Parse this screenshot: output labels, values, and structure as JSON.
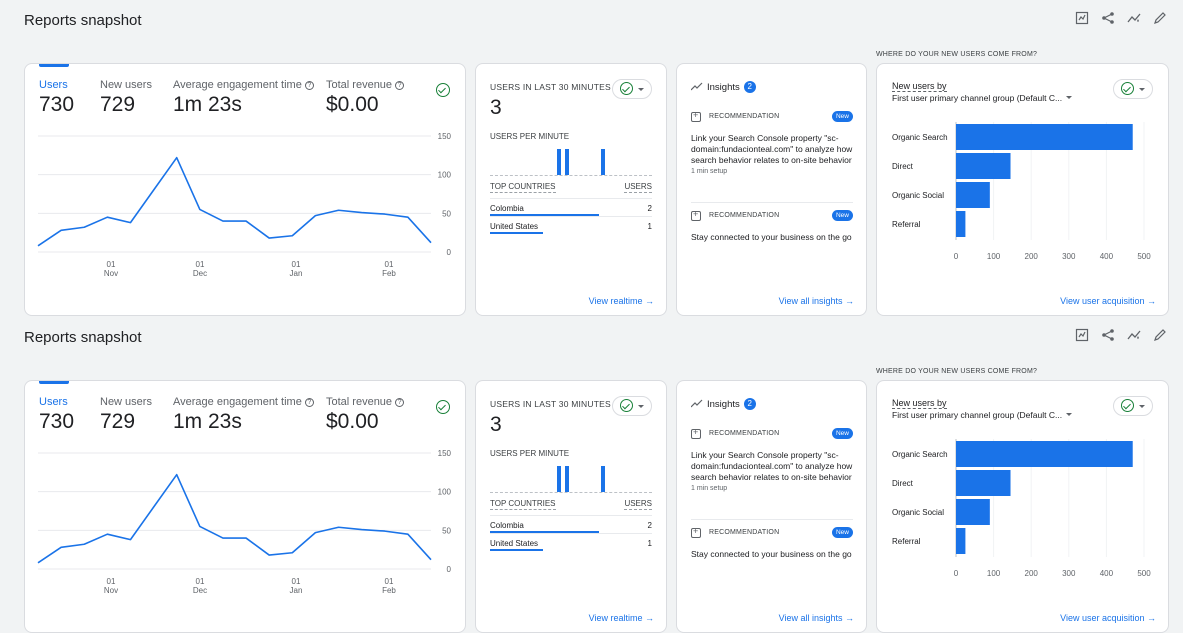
{
  "sections": [
    {
      "title": "Reports snapshot",
      "metrics": [
        {
          "label": "Users",
          "value": "730"
        },
        {
          "label": "New users",
          "value": "729"
        },
        {
          "label": "Average engagement time",
          "value": "1m 23s",
          "help": "?"
        },
        {
          "label": "Total revenue",
          "value": "$0.00",
          "help": "?"
        }
      ],
      "realtime": {
        "title": "USERS IN LAST 30 MINUTES",
        "count": "3",
        "per_minute_label": "USERS PER MINUTE",
        "col_country": "TOP COUNTRIES",
        "col_users": "USERS",
        "rows": [
          {
            "country": "Colombia",
            "users": "2",
            "share": 0.67
          },
          {
            "country": "United States",
            "users": "1",
            "share": 0.33
          }
        ],
        "link": "View realtime →"
      },
      "insights": {
        "title": "Insights",
        "badge": "2",
        "recommendations": [
          {
            "label": "RECOMMENDATION",
            "badge": "New",
            "text": "Link your Search Console property \"sc-domain:fundacionteal.com\" to analyze how search behavior relates to on-site behavior",
            "setup": "1 min setup"
          },
          {
            "label": "RECOMMENDATION",
            "badge": "New",
            "text": "Stay connected to your business on the go",
            "setup": ""
          }
        ],
        "link": "View all insights →"
      },
      "acquisition": {
        "kicker": "WHERE DO YOUR NEW USERS COME FROM?",
        "dimension_line1": "New users by",
        "dimension_line2": "First user primary channel group (Default C...",
        "link": "View user acquisition →"
      }
    },
    {
      "title": "Reports snapshot",
      "metrics": [
        {
          "label": "Users",
          "value": "730"
        },
        {
          "label": "New users",
          "value": "729"
        },
        {
          "label": "Average engagement time",
          "value": "1m 23s",
          "help": "?"
        },
        {
          "label": "Total revenue",
          "value": "$0.00",
          "help": "?"
        }
      ],
      "realtime": {
        "title": "USERS IN LAST 30 MINUTES",
        "count": "3",
        "per_minute_label": "USERS PER MINUTE",
        "col_country": "TOP COUNTRIES",
        "col_users": "USERS",
        "rows": [
          {
            "country": "Colombia",
            "users": "2",
            "share": 0.67
          },
          {
            "country": "United States",
            "users": "1",
            "share": 0.33
          }
        ],
        "link": "View realtime →"
      },
      "insights": {
        "title": "Insights",
        "badge": "2",
        "recommendations": [
          {
            "label": "RECOMMENDATION",
            "badge": "New",
            "text": "Link your Search Console property \"sc-domain:fundacionteal.com\" to analyze how search behavior relates to on-site behavior",
            "setup": "1 min setup"
          },
          {
            "label": "RECOMMENDATION",
            "badge": "New",
            "text": "Stay connected to your business on the go",
            "setup": ""
          }
        ],
        "link": "View all insights →"
      },
      "acquisition": {
        "kicker": "WHERE DO YOUR NEW USERS COME FROM?",
        "dimension_line1": "New users by",
        "dimension_line2": "First user primary channel group (Default C...",
        "link": "View user acquisition →"
      }
    }
  ],
  "colors": {
    "accent": "#1a73e8",
    "success": "#188038",
    "grid": "#e8eaed"
  },
  "icons": [
    "customize-report-icon",
    "share-icon",
    "insights-icon",
    "edit-icon",
    "check-circle-icon",
    "help-icon",
    "recommendation-icon"
  ],
  "chart_data": [
    {
      "type": "line",
      "series": [
        {
          "name": "Users",
          "values": [
            8,
            28,
            32,
            45,
            38,
            80,
            122,
            55,
            40,
            40,
            18,
            21,
            47,
            54,
            51,
            49,
            45,
            12
          ]
        }
      ],
      "x_tick_labels": [
        [
          "01",
          "Nov"
        ],
        [
          "01",
          "Dec"
        ],
        [
          "01",
          "Jan"
        ],
        [
          "01",
          "Feb"
        ]
      ],
      "y_ticks": [
        0,
        50,
        100,
        150
      ],
      "ylim": [
        0,
        150
      ]
    },
    {
      "type": "bar",
      "categories": [
        "Organic Search",
        "Direct",
        "Organic Social",
        "Referral"
      ],
      "values": [
        470,
        145,
        90,
        25
      ],
      "x_ticks": [
        0,
        100,
        200,
        300,
        400,
        500
      ],
      "xlim": [
        0,
        500
      ]
    },
    {
      "type": "bar",
      "title": "USERS PER MINUTE",
      "values_nonzero": 3
    }
  ]
}
